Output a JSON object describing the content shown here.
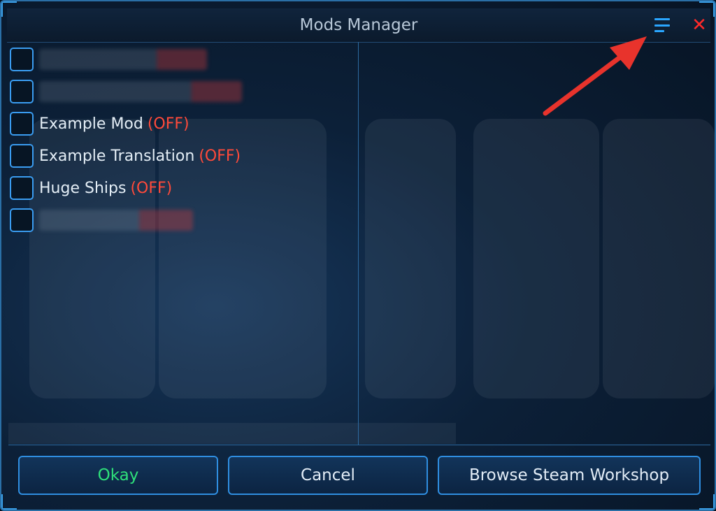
{
  "window": {
    "title": "Mods Manager"
  },
  "icons": {
    "menu": "menu-list-icon",
    "close": "close-icon"
  },
  "mods": [
    {
      "name": "",
      "status": "",
      "blurred": true
    },
    {
      "name": "",
      "status": "",
      "blurred": true
    },
    {
      "name": "Example Mod",
      "status": "(OFF)",
      "blurred": false,
      "checked": false
    },
    {
      "name": "Example Translation",
      "status": "(OFF)",
      "blurred": false,
      "checked": false
    },
    {
      "name": "Huge Ships",
      "status": "(OFF)",
      "blurred": false,
      "checked": false
    },
    {
      "name": "",
      "status": "",
      "blurred": true
    }
  ],
  "buttons": {
    "okay": "Okay",
    "cancel": "Cancel",
    "browse": "Browse Steam Workshop"
  },
  "colors": {
    "accent": "#3a9cf0",
    "status_off": "#ff4a3a",
    "okay_text": "#2ee07a",
    "close": "#ff2a2a",
    "annotation_arrow": "#e8332c"
  }
}
